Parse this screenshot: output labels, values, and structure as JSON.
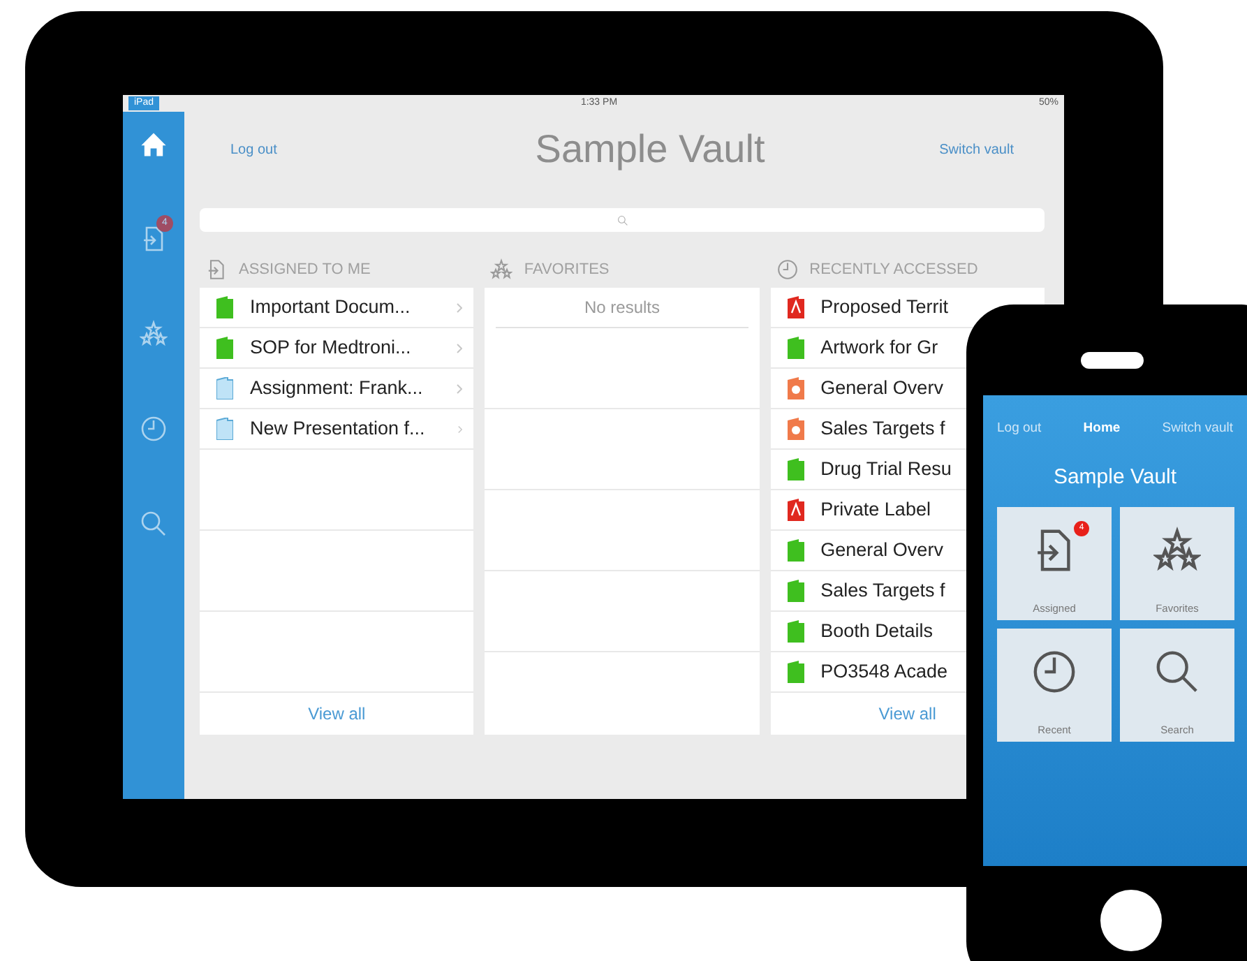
{
  "tablet": {
    "status_bar": {
      "carrier": "iPad",
      "time": "1:33 PM",
      "battery": "50%"
    },
    "sidebar": {
      "items": [
        {
          "kind": "home",
          "selected": true
        },
        {
          "kind": "assigned",
          "selected": false,
          "badge": "4"
        },
        {
          "kind": "favorites",
          "selected": false
        },
        {
          "kind": "recent",
          "selected": false
        },
        {
          "kind": "search",
          "selected": false
        }
      ]
    },
    "header": {
      "left_link": "Log out",
      "title": "Sample Vault",
      "right_link": "Switch vault"
    },
    "columns": [
      {
        "kind": "assigned",
        "title": "ASSIGNED TO ME",
        "items": [
          {
            "kind": "green",
            "label": "Important Docum..."
          },
          {
            "kind": "green",
            "label": "SOP for Medtroni..."
          },
          {
            "kind": "blue",
            "label": "Assignment: Frank..."
          },
          {
            "kind": "blue",
            "label": "New Presentation f..."
          }
        ],
        "footer_link": "View all"
      },
      {
        "kind": "favorites",
        "title": "FAVORITES",
        "empty_text": "No results"
      },
      {
        "kind": "recent",
        "title": "RECENTLY ACCESSED",
        "items": [
          {
            "kind": "pdf",
            "label": "Proposed Territ"
          },
          {
            "kind": "green",
            "label": "Artwork for Gr"
          },
          {
            "kind": "slides",
            "label": "General Overv"
          },
          {
            "kind": "slides",
            "label": "Sales Targets f"
          },
          {
            "kind": "green",
            "label": "Drug Trial Resu"
          },
          {
            "kind": "pdf",
            "label": "Private Label"
          },
          {
            "kind": "green",
            "label": "General Overv"
          },
          {
            "kind": "green",
            "label": "Sales Targets f"
          },
          {
            "kind": "green",
            "label": "Booth Details"
          },
          {
            "kind": "green",
            "label": "PO3548 Acade"
          }
        ],
        "footer_link": "View all"
      }
    ]
  },
  "phone": {
    "nav": {
      "left_link": "Log out",
      "title": "Home",
      "right_link": "Switch vault"
    },
    "title": "Sample Vault",
    "tiles": [
      {
        "kind": "assigned",
        "label": "Assigned",
        "badge": "4"
      },
      {
        "kind": "favorites",
        "label": "Favorites"
      },
      {
        "kind": "recent",
        "label": "Recent"
      },
      {
        "kind": "search",
        "label": "Search"
      }
    ]
  }
}
